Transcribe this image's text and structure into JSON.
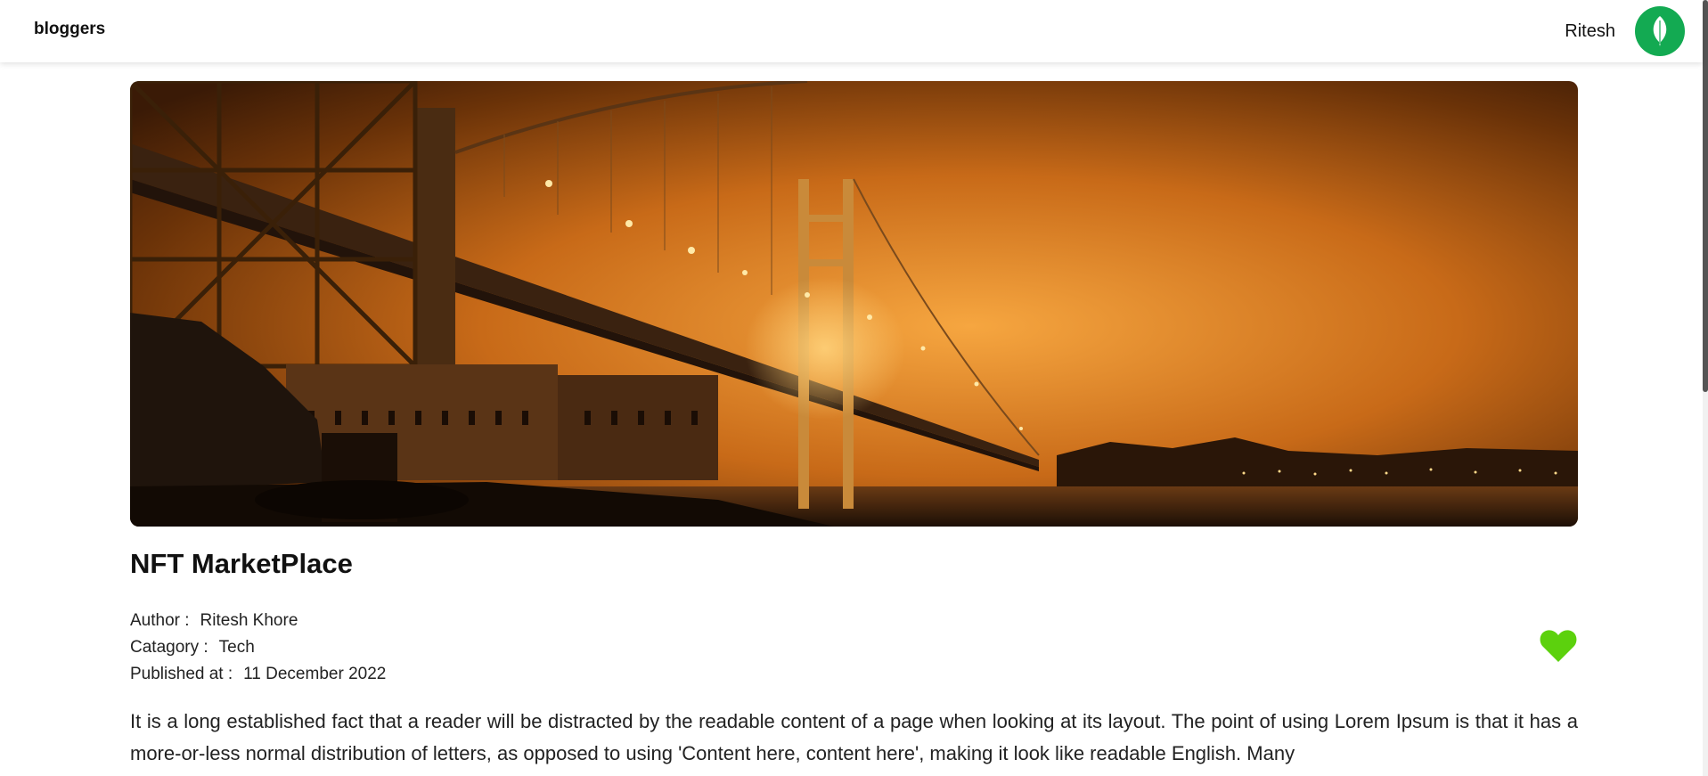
{
  "nav": {
    "brand": "bloggers",
    "username": "Ritesh",
    "avatar_icon": "leaf-icon",
    "avatar_color": "#13aa52"
  },
  "post": {
    "hero_image": "golden-gate-bridge-night-fog-photo",
    "title": "NFT MarketPlace",
    "author_label": "Author :",
    "author": "Ritesh Khore",
    "category_label": "Catagory :",
    "category": "Tech",
    "published_label": "Published at :",
    "published": "11 December 2022",
    "like_icon": "heart-icon",
    "like_color": "#5cd10d",
    "body": "It is a long established fact that a reader will be distracted by the readable content of a page when looking at its layout. The point of using Lorem Ipsum is that it has a more-or-less normal distribution of letters, as opposed to using 'Content here, content here', making it look like readable English. Many"
  }
}
